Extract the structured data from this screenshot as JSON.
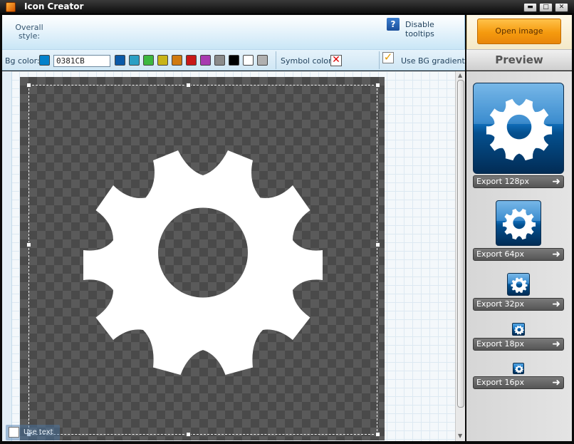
{
  "window": {
    "title": "Icon Creator",
    "min_glyph": "▬",
    "max_glyph": "□",
    "close_glyph": "✕"
  },
  "top": {
    "overall_style_label": "Overall style:",
    "disable_tooltips_label": "Disable tooltips",
    "help_glyph": "?",
    "open_image_label": "Open image"
  },
  "toolbar": {
    "bg_color_label": "Bg color:",
    "bg_color_value": "0381CB",
    "symbol_color_label": "Symbol color:",
    "use_bg_gradient_label": "Use BG gradient",
    "current_swatch": "#0381CB",
    "swatches": [
      "#0a5aa8",
      "#2a9fc4",
      "#3cb840",
      "#c8b418",
      "#d07a10",
      "#c81818",
      "#a83ab0",
      "#8a8a8a",
      "#000000",
      "#ffffff",
      "#b0b0b0"
    ]
  },
  "preview": {
    "header": "Preview",
    "exports": [
      "Export 128px",
      "Export 64px",
      "Export 32px",
      "Export 18px",
      "Export 16px"
    ],
    "arrow_glyph": "➜"
  },
  "canvas": {
    "use_text_label": "Use text"
  },
  "icons": {
    "symbol": "gear-icon",
    "arrow": "arrow-right-icon"
  }
}
